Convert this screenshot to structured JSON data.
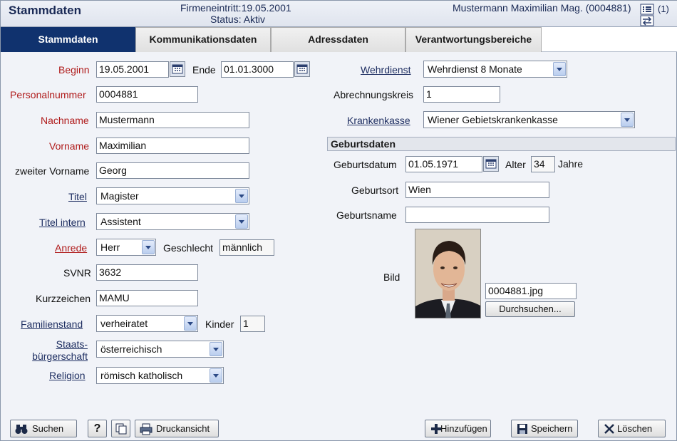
{
  "header": {
    "title": "Stammdaten",
    "entry": "Firmeneintritt:19.05.2001",
    "status": "Status: Aktiv",
    "user": "Mustermann Maximilian Mag. (0004881)",
    "count": "(1)"
  },
  "tabs": [
    "Stammdaten",
    "Kommunikationsdaten",
    "Adressdaten",
    "Verantwortungsbereiche"
  ],
  "left": {
    "beginn": {
      "label": "Beginn",
      "value": "19.05.2001"
    },
    "ende": {
      "label": "Ende",
      "value": "01.01.3000"
    },
    "personalnummer": {
      "label": "Personalnummer",
      "value": "0004881"
    },
    "nachname": {
      "label": "Nachname",
      "value": "Mustermann"
    },
    "vorname": {
      "label": "Vorname",
      "value": "Maximilian"
    },
    "zweiter_vorname": {
      "label": "zweiter Vorname",
      "value": "Georg"
    },
    "titel": {
      "label": "Titel",
      "value": "Magister"
    },
    "titel_intern": {
      "label": "Titel intern",
      "value": "Assistent"
    },
    "anrede": {
      "label": "Anrede",
      "value": "Herr"
    },
    "geschlecht": {
      "label": "Geschlecht",
      "value": "männlich"
    },
    "svnr": {
      "label": "SVNR",
      "value": "3632"
    },
    "kurzzeichen": {
      "label": "Kurzzeichen",
      "value": "MAMU"
    },
    "familienstand": {
      "label": "Familienstand",
      "value": "verheiratet"
    },
    "kinder": {
      "label": "Kinder",
      "value": "1"
    },
    "staatsbuergerschaft": {
      "label1": "Staats-",
      "label2": "bürgerschaft",
      "value": "österreichisch"
    },
    "religion": {
      "label": "Religion",
      "value": "römisch katholisch"
    }
  },
  "right": {
    "wehrdienst": {
      "label": "Wehrdienst",
      "value": "Wehrdienst 8 Monate"
    },
    "abrechnungskreis": {
      "label": "Abrechnungskreis",
      "value": "1"
    },
    "krankenkasse": {
      "label": "Krankenkasse",
      "value": "Wiener Gebietskrankenkasse"
    },
    "section": "Geburtsdaten",
    "geburtsdatum": {
      "label": "Geburtsdatum",
      "value": "01.05.1971"
    },
    "alter": {
      "label": "Alter",
      "value": "34",
      "unit": "Jahre"
    },
    "geburtsort": {
      "label": "Geburtsort",
      "value": "Wien"
    },
    "geburtsname": {
      "label": "Geburtsname",
      "value": ""
    },
    "bild": {
      "label": "Bild",
      "file": "0004881.jpg",
      "browse": "Durchsuchen..."
    }
  },
  "footer": {
    "search": "Suchen",
    "help": "?",
    "print": "Druckansicht",
    "add": "Hinzufügen",
    "save": "Speichern",
    "delete": "Löschen"
  }
}
